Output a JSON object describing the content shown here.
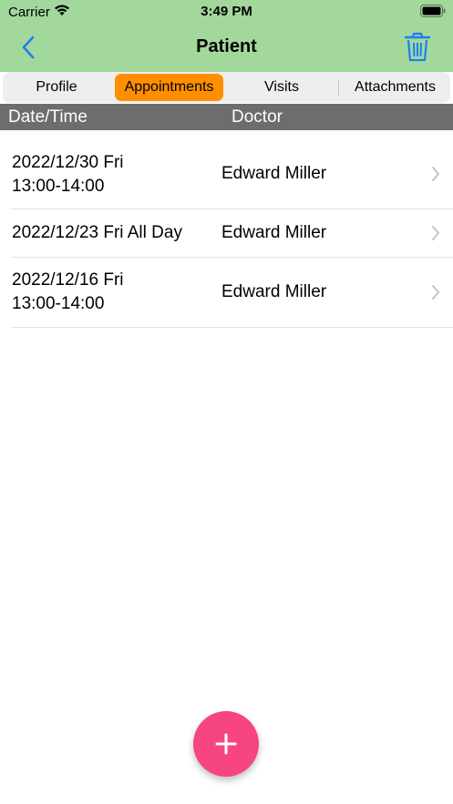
{
  "status_bar": {
    "carrier": "Carrier",
    "time": "3:49 PM"
  },
  "nav": {
    "title": "Patient"
  },
  "tabs": [
    {
      "label": "Profile",
      "active": false
    },
    {
      "label": "Appointments",
      "active": true
    },
    {
      "label": "Visits",
      "active": false
    },
    {
      "label": "Attachments",
      "active": false
    }
  ],
  "columns": {
    "datetime": "Date/Time",
    "doctor": "Doctor"
  },
  "appointments": [
    {
      "datetime": "2022/12/30 Fri\n13:00-14:00",
      "doctor": "Edward Miller"
    },
    {
      "datetime": "2022/12/23 Fri All Day",
      "doctor": "Edward Miller"
    },
    {
      "datetime": "2022/12/16 Fri\n13:00-14:00",
      "doctor": "Edward Miller"
    }
  ],
  "colors": {
    "header": "#a3d89d",
    "accent_blue": "#1a7ff2",
    "tab_active": "#ff8f00",
    "column_header": "#6d6d6d",
    "fab": "#f6457f"
  },
  "icons": {
    "back": "chevron-left-icon",
    "trash": "trash-icon",
    "row": "chevron-right-icon",
    "fab": "plus-icon"
  }
}
